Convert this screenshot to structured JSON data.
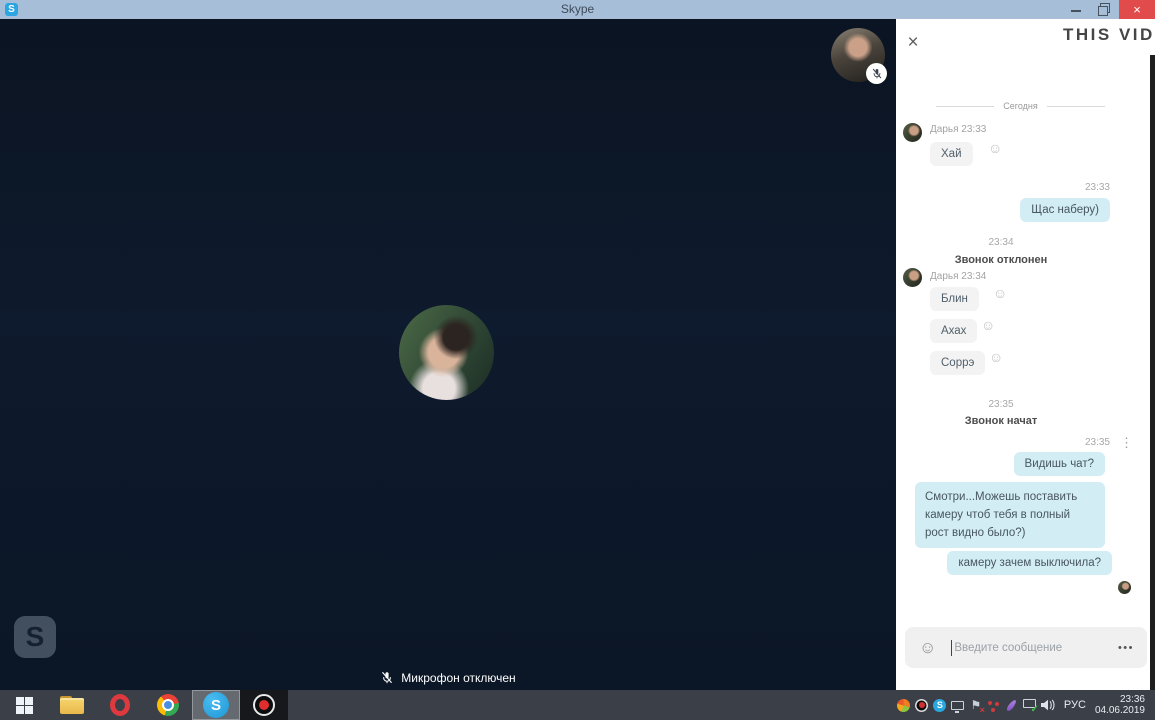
{
  "window": {
    "title": "Skype"
  },
  "call": {
    "video_watermark": "THIS VID",
    "logo_letter": "S",
    "mic_status": "Микрофон отключен"
  },
  "chat": {
    "date_divider": "Сегодня",
    "messages": [
      {
        "type": "incoming_header",
        "text": "Дарья 23:33"
      },
      {
        "type": "incoming",
        "text": "Хай"
      },
      {
        "type": "timestamp",
        "text": "23:33"
      },
      {
        "type": "outgoing",
        "text": "Щас наберу)"
      },
      {
        "type": "timestamp",
        "text": "23:34"
      },
      {
        "type": "system",
        "text": "Звонок отклонен"
      },
      {
        "type": "incoming_header",
        "text": "Дарья 23:34"
      },
      {
        "type": "incoming",
        "text": "Блин"
      },
      {
        "type": "incoming",
        "text": "Ахах"
      },
      {
        "type": "incoming",
        "text": "Соррэ"
      },
      {
        "type": "timestamp",
        "text": "23:35"
      },
      {
        "type": "system",
        "text": "Звонок начат"
      },
      {
        "type": "timestamp",
        "text": "23:35"
      },
      {
        "type": "outgoing",
        "text": "Видишь чат?"
      },
      {
        "type": "outgoing",
        "text": "Смотри...Можешь поставить камеру чтоб тебя в полный рост видно было?)"
      },
      {
        "type": "outgoing",
        "text": "камеру зачем выключила?"
      }
    ],
    "input": {
      "value": "",
      "placeholder": "Введите сообщение"
    }
  },
  "icons": {
    "close": "×",
    "smiley": "☺",
    "kebab": "⋮",
    "more": "•••",
    "skype_letter": "S",
    "flag": "⚑",
    "check": "✓",
    "badge_x": "×"
  },
  "taskbar": {
    "language": "РУС",
    "time": "23:36",
    "date": "04.06.2019"
  },
  "colors": {
    "titlebar": "#a6bed8",
    "close_button": "#e14b4b",
    "video_bg": "#0d1726",
    "skype_blue": "#29a8e0",
    "sent_bubble": "#d3edf5",
    "received_bubble": "#f3f3f3",
    "taskbar": "#3a3f48"
  }
}
